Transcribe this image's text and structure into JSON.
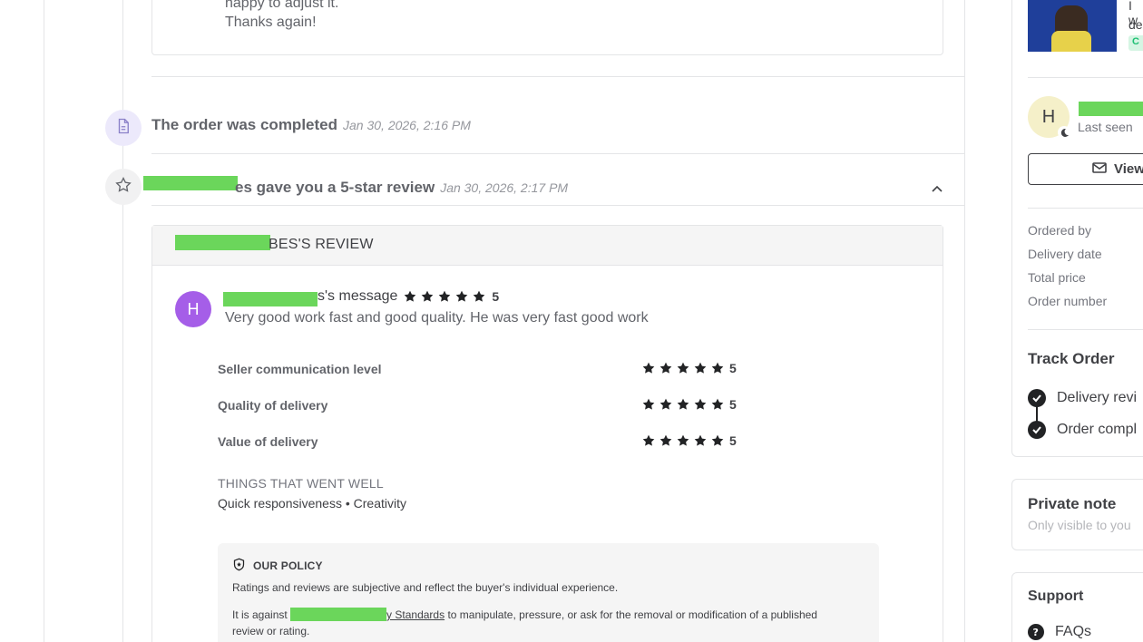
{
  "message_card": {
    "line1": "happy to adjust it.",
    "line2": "Thanks again!"
  },
  "events": [
    {
      "title": "The order was completed",
      "date": "Jan 30, 2026, 2:16 PM",
      "icon": "document-icon"
    },
    {
      "title": "es gave you a 5-star review",
      "date": "Jan 30, 2026, 2:17 PM",
      "icon": "star-outline-icon"
    }
  ],
  "review": {
    "header": "BES'S REVIEW",
    "avatar_initial": "H",
    "message_label": "s's message",
    "overall_rating": "5",
    "message": "Very good work fast and good quality. He was very fast good work",
    "criteria": [
      {
        "label": "Seller communication level",
        "rating": "5"
      },
      {
        "label": "Quality of delivery",
        "rating": "5"
      },
      {
        "label": "Value of delivery",
        "rating": "5"
      }
    ],
    "went_well_title": "THINGS THAT WENT WELL",
    "went_well_items": "Quick responsiveness  •  Creativity",
    "policy": {
      "title": "OUR POLICY",
      "p1": "Ratings and reviews are subjective and reflect the buyer's individual experience.",
      "p2_prefix": "It is against",
      "p2_link": "y Standards",
      "p2_suffix": "to manipulate, pressure, or ask for the removal or modification of a published",
      "p2_line2": "review or rating."
    }
  },
  "sidebar": {
    "gig_snippet_1": "I w",
    "gig_snippet_2": "de",
    "gig_badge": "C",
    "seller_initial": "H",
    "last_seen": "Last seen",
    "view_button": "View",
    "order_labels": [
      "Ordered by",
      "Delivery date",
      "Total price",
      "Order number"
    ],
    "track_title": "Track Order",
    "track_items": [
      "Delivery revi",
      "Order compl"
    ],
    "private_note_title": "Private note",
    "private_note_sub": "Only visible to you",
    "support_title": "Support",
    "faqs": "FAQs"
  },
  "colors": {
    "accent_purple": "#a55ee8",
    "redaction_green": "#6bd65b",
    "star_color": "#222325"
  }
}
